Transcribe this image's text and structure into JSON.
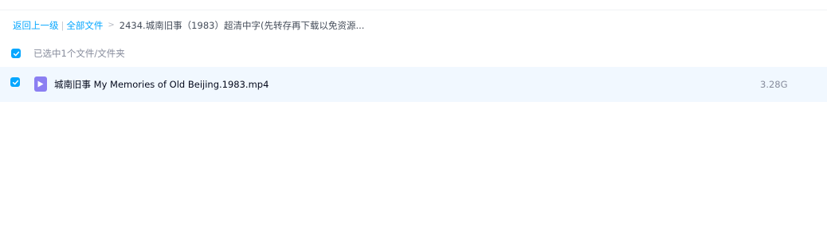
{
  "breadcrumb": {
    "back_label": "返回上一级",
    "separator_bar": "|",
    "all_files_label": "全部文件",
    "separator_arrow": ">",
    "current_folder": "2434.城南旧事（1983）超清中字(先转存再下载以免资源..."
  },
  "selection": {
    "summary": "已选中1个文件/文件夹",
    "all_checked": true
  },
  "files": [
    {
      "name": "城南旧事 My Memories of Old Beijing.1983.mp4",
      "size": "3.28G",
      "checked": true,
      "icon": "video-file-icon"
    }
  ],
  "colors": {
    "accent": "#06a7ff",
    "row_selected_bg": "#f1f8ff",
    "video_icon": "#8b7ff2",
    "muted_text": "#878c9c"
  }
}
